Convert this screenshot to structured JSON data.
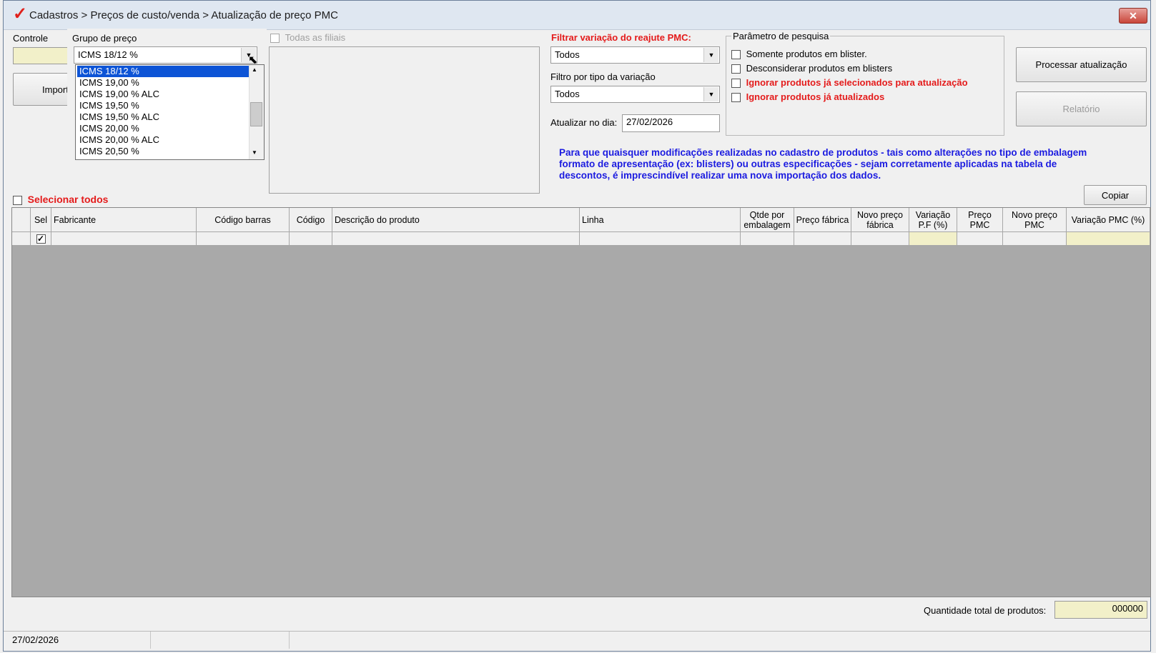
{
  "window": {
    "title": "Cadastros > Preços de custo/venda > Atualização de preço PMC",
    "close_label": "✕"
  },
  "form": {
    "controle_label": "Controle",
    "controle_value": "",
    "grupo_label": "Grupo de preço",
    "grupo_value": "ICMS 18/12 %",
    "importar_label": "Importa",
    "todas_filiais_label": "Todas as filiais",
    "filtrar_variacao_label": "Filtrar variação do reajute PMC:",
    "filtrar_variacao_value": "Todos",
    "filtro_tipo_label": "Filtro por tipo da variação",
    "filtro_tipo_value": "Todos",
    "atualizar_label": "Atualizar no dia:",
    "atualizar_value": "27/02/2026"
  },
  "dropdown": {
    "items": [
      "ICMS 18/12 %",
      "ICMS 19,00 %",
      "ICMS 19,00 % ALC",
      "ICMS 19,50 %",
      "ICMS 19,50 % ALC",
      "ICMS 20,00 %",
      "ICMS 20,00 % ALC",
      "ICMS 20,50 %"
    ],
    "selected_index": 0
  },
  "search_params": {
    "title": "Parâmetro de pesquisa",
    "options": [
      {
        "label": "Somente produtos em blister.",
        "checked": false,
        "red": false
      },
      {
        "label": "Desconsiderar produtos em blisters",
        "checked": false,
        "red": false
      },
      {
        "label": "Ignorar produtos já selecionados para atualização",
        "checked": false,
        "red": true
      },
      {
        "label": "Ignorar produtos já atualizados",
        "checked": false,
        "red": true
      }
    ]
  },
  "buttons": {
    "processar": "Processar atualização",
    "relatorio": "Relatório",
    "copiar": "Copiar"
  },
  "note": {
    "line1": "Para que quaisquer modificações realizadas no cadastro de produtos - tais como alterações no tipo de embalagem",
    "line2": "formato de apresentação (ex: blisters) ou outras especificações - sejam corretamente aplicadas na tabela de",
    "line3": "descontos, é imprescindível realizar uma nova importação dos dados."
  },
  "selecionar_todos": "Selecionar todos",
  "grid": {
    "columns": [
      "",
      "Sel",
      "Fabricante",
      "Código barras",
      "Código",
      "Descrição do produto",
      "Linha",
      "Qtde por embalagem",
      "Preço fábrica",
      "Novo preço fábrica",
      "Variação P.F (%)",
      "Preço PMC",
      "Novo preço PMC",
      "Variação PMC (%)"
    ],
    "first_row_checked": true
  },
  "footer": {
    "total_label": "Quantidade total de produtos:",
    "total_value": "000000"
  },
  "status": {
    "date": "27/02/2026"
  },
  "colors": {
    "accent_red": "#e41b1b",
    "note_blue": "#1b1be0",
    "selection_blue": "#0d54d6",
    "yellow_field": "#f2f0c9"
  }
}
